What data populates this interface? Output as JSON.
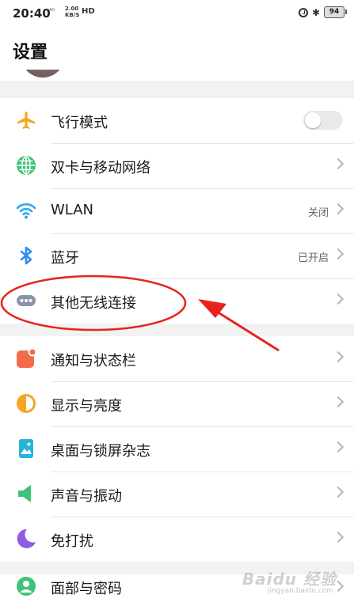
{
  "status_bar": {
    "time": "20:40",
    "network": "⁴ᴳ",
    "speed": "2.00",
    "speed_unit": "KB/S",
    "hd": "HD",
    "battery": "94"
  },
  "header": {
    "title": "设置"
  },
  "groups": [
    {
      "items": [
        {
          "label": "飞行模式",
          "icon": "airplane-icon",
          "toggle_on": false
        },
        {
          "label": "双卡与移动网络",
          "icon": "globe-icon"
        },
        {
          "label": "WLAN",
          "icon": "wifi-icon",
          "value": "关闭"
        },
        {
          "label": "蓝牙",
          "icon": "bluetooth-icon",
          "value": "已开启"
        },
        {
          "label": "其他无线连接",
          "icon": "more-dots-icon"
        }
      ]
    },
    {
      "items": [
        {
          "label": "通知与状态栏",
          "icon": "notification-icon"
        },
        {
          "label": "显示与亮度",
          "icon": "brightness-icon"
        },
        {
          "label": "桌面与锁屏杂志",
          "icon": "wallpaper-icon"
        },
        {
          "label": "声音与振动",
          "icon": "speaker-icon"
        },
        {
          "label": "免打扰",
          "icon": "moon-icon"
        }
      ]
    },
    {
      "items": [
        {
          "label": "面部与密码",
          "icon": "face-icon"
        }
      ]
    }
  ],
  "watermark": {
    "text": "Baidu 经验",
    "sub": "jingyan.baidu.com"
  },
  "colors": {
    "airplane": "#f5a623",
    "globe": "#3fc37a",
    "wifi": "#2ea8f0",
    "bluetooth": "#2e8df0",
    "dots": "#8a94a6",
    "notification": "#f26b4a",
    "brightness": "#f5a623",
    "wallpaper": "#27b3d8",
    "speaker": "#3fc37a",
    "moon": "#8e5ce6",
    "face": "#3fc37a",
    "annotation": "#e8231f"
  }
}
